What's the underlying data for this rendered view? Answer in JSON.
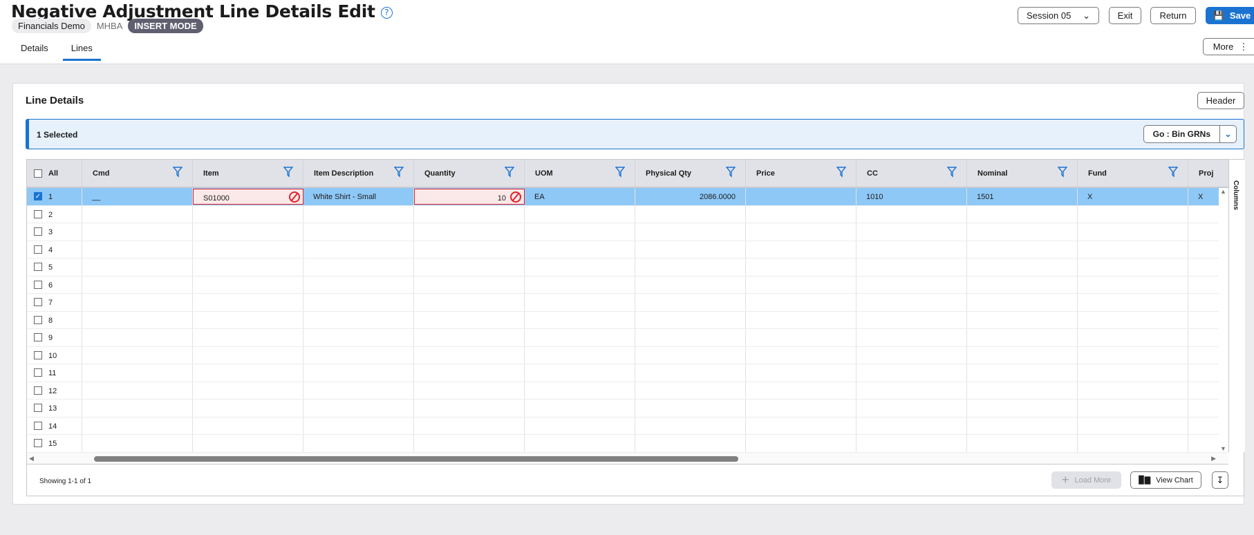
{
  "header": {
    "title": "Negative Adjustment Line Details Edit",
    "help_icon": "?",
    "company": "Financials Demo",
    "code": "MHBA",
    "mode": "INSERT MODE",
    "session": "Session 05",
    "exit": "Exit",
    "return": "Return",
    "save": "Save",
    "more": "More"
  },
  "tabs": [
    "Details",
    "Lines"
  ],
  "card": {
    "title": "Line Details",
    "header_button": "Header",
    "selected": "1 Selected",
    "go_button": "Go : Bin GRNs"
  },
  "table": {
    "all_label": "All",
    "columns": [
      "Cmd",
      "Item",
      "Item Description",
      "Quantity",
      "UOM",
      "Physical Qty",
      "Price",
      "CC",
      "Nominal",
      "Fund",
      "Proj"
    ],
    "rows": [
      {
        "n": "1",
        "checked": true,
        "cells": [
          "__",
          "S01000",
          "White Shirt - Small",
          "10",
          "EA",
          "2086.0000",
          "",
          "1010",
          "1501",
          "X",
          "X"
        ]
      },
      {
        "n": "2"
      },
      {
        "n": "3"
      },
      {
        "n": "4"
      },
      {
        "n": "5"
      },
      {
        "n": "6"
      },
      {
        "n": "7"
      },
      {
        "n": "8"
      },
      {
        "n": "9"
      },
      {
        "n": "10"
      },
      {
        "n": "11"
      },
      {
        "n": "12"
      },
      {
        "n": "13"
      },
      {
        "n": "14"
      },
      {
        "n": "15"
      }
    ],
    "columns_panel": "Columns"
  },
  "footer": {
    "showing": "Showing 1-1 of 1",
    "load_more": "Load More",
    "view_chart": "View Chart"
  }
}
